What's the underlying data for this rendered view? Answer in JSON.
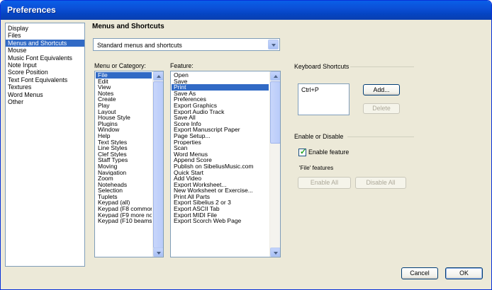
{
  "window": {
    "title": "Preferences"
  },
  "categories": {
    "items": [
      "Display",
      "Files",
      "Menus and Shortcuts",
      "Mouse",
      "Music Font Equivalents",
      "Note Input",
      "Score Position",
      "Text Font Equivalents",
      "Textures",
      "Word Menus",
      "Other"
    ],
    "selected_index": 2
  },
  "section": {
    "title": "Menus and Shortcuts"
  },
  "preset_combo": {
    "value": "Standard menus and shortcuts",
    "icon": "chevron-down-icon"
  },
  "menu_list": {
    "label": "Menu or Category:",
    "items": [
      "File",
      "Edit",
      "View",
      "Notes",
      "Create",
      "Play",
      "Layout",
      "House Style",
      "Plugins",
      "Window",
      "Help",
      "Text Styles",
      "Line Styles",
      "Clef Styles",
      "Staff Types",
      "Moving",
      "Navigation",
      "Zoom",
      "Noteheads",
      "Selection",
      "Tuplets",
      "Keypad (all)",
      "Keypad (F8 common",
      "Keypad (F9 more not",
      "Keypad (F10 beams"
    ],
    "selected_index": 0
  },
  "feature_list": {
    "label": "Feature:",
    "items": [
      "Open",
      "Save",
      "Print",
      "Save As",
      "Preferences",
      "Export Graphics",
      "Export Audio Track",
      "Save All",
      "Score Info",
      "Export Manuscript Paper",
      "Page Setup...",
      "Properties",
      "Scan",
      "Word Menus",
      "Append Score",
      "Publish on SibeliusMusic.com",
      "Quick Start",
      "Add Video",
      "Export Worksheet...",
      "New Worksheet or Exercise...",
      "Print All Parts",
      "Export Sibelius 2 or 3",
      "Export ASCII Tab",
      "Export MIDI File",
      "Export Scorch Web Page"
    ],
    "selected_index": 2
  },
  "keyboard_shortcuts": {
    "group_label": "Keyboard Shortcuts",
    "shortcuts": [
      "Ctrl+P"
    ],
    "add_label": "Add...",
    "delete_label": "Delete"
  },
  "enable": {
    "group_label": "Enable or Disable",
    "checkbox_label": "Enable feature",
    "checked": true,
    "features_label": "'File' features",
    "enable_all_label": "Enable All",
    "disable_all_label": "Disable All"
  },
  "footer": {
    "cancel_label": "Cancel",
    "ok_label": "OK"
  },
  "colors": {
    "selection": "#316ac5",
    "title_bar": "#0b50d7",
    "dialog_bg": "#ece9d8"
  }
}
